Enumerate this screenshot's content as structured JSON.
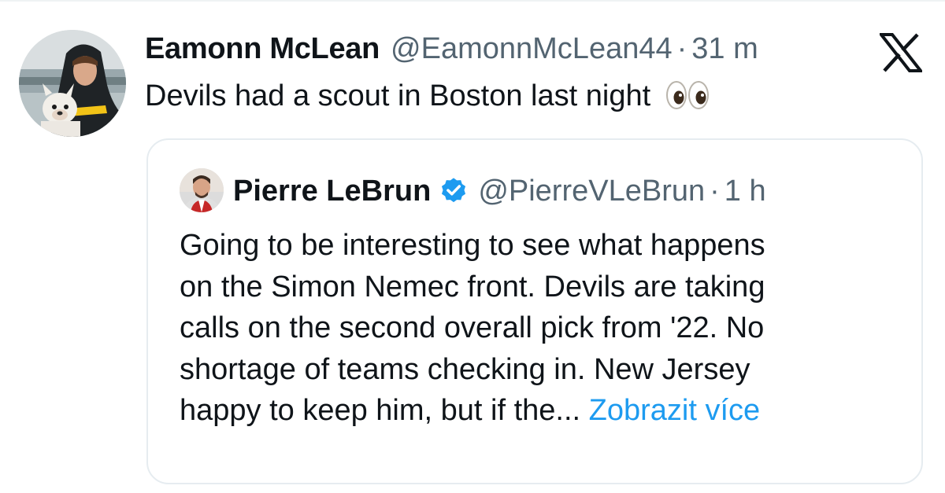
{
  "tweet": {
    "author": {
      "display_name": "Eamonn McLean",
      "handle": "@EamonnMcLean44",
      "time": "31 m",
      "avatar_icon": "profile-photo-with-dog"
    },
    "separator": "·",
    "text": "Devils had a scout in Boston last night",
    "emoji_icon": "eyes-emoji"
  },
  "brand": {
    "logo_icon": "x-logo"
  },
  "quote": {
    "author": {
      "display_name": "Pierre LeBrun",
      "handle": "@PierreVLeBrun",
      "time": "1 h",
      "verified_icon": "verified-badge",
      "avatar_icon": "profile-photo"
    },
    "separator": "·",
    "lines": [
      "Going to be interesting to see what happens",
      "on the Simon Nemec front. Devils are taking",
      "calls on the second overall pick from '22. No",
      "shortage of teams checking in. New Jersey"
    ],
    "last_line": "happy to keep him, but if the...",
    "show_more": "Zobrazit více"
  },
  "colors": {
    "text": "#0f1419",
    "secondary": "#536471",
    "link": "#1d9bf0",
    "border": "#e6ecf0"
  }
}
